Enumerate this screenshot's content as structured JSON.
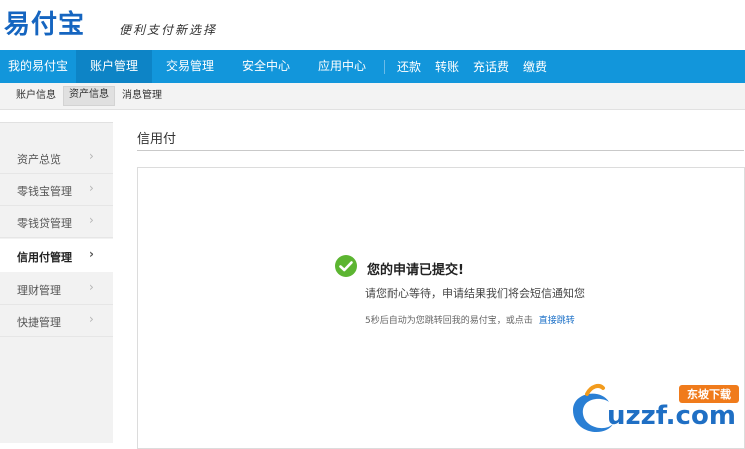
{
  "header": {
    "logo_text": "易付宝",
    "slogan": "便利支付新选择"
  },
  "mainnav": {
    "items": [
      {
        "label": "我的易付宝"
      },
      {
        "label": "账户管理"
      },
      {
        "label": "交易管理"
      },
      {
        "label": "安全中心"
      },
      {
        "label": "应用中心"
      }
    ],
    "active": "账户管理",
    "quick_links": [
      {
        "label": "还款"
      },
      {
        "label": "转账"
      },
      {
        "label": "充话费"
      },
      {
        "label": "缴费"
      }
    ],
    "colors": {
      "bar": "#1296db",
      "active": "#0d84c6"
    }
  },
  "subnav": {
    "items": [
      {
        "label": "账户信息"
      },
      {
        "label": "资产信息"
      },
      {
        "label": "消息管理"
      }
    ],
    "active": "资产信息"
  },
  "sidebar": {
    "items": [
      {
        "label": "资产总览",
        "icon": "chevron-right-icon"
      },
      {
        "label": "零钱宝管理",
        "icon": "chevron-right-icon"
      },
      {
        "label": "零钱贷管理",
        "icon": "chevron-right-icon"
      },
      {
        "label": "信用付管理",
        "icon": "chevron-right-icon"
      },
      {
        "label": "理财管理",
        "icon": "chevron-right-icon"
      },
      {
        "label": "快捷管理",
        "icon": "chevron-right-icon"
      }
    ],
    "active": "信用付管理"
  },
  "content": {
    "title": "信用付",
    "success_title": "您的申请已提交!",
    "success_desc": "请您耐心等待，申请结果我们将会短信通知您",
    "redirect_text": "5秒后自动为您跳转回我的易付宝，或点击",
    "redirect_link": "直接跳转",
    "icon": "check-circle-icon",
    "accent": "#5cb531"
  },
  "watermark": {
    "text": "uzzf.com",
    "badge": "东坡下载"
  }
}
